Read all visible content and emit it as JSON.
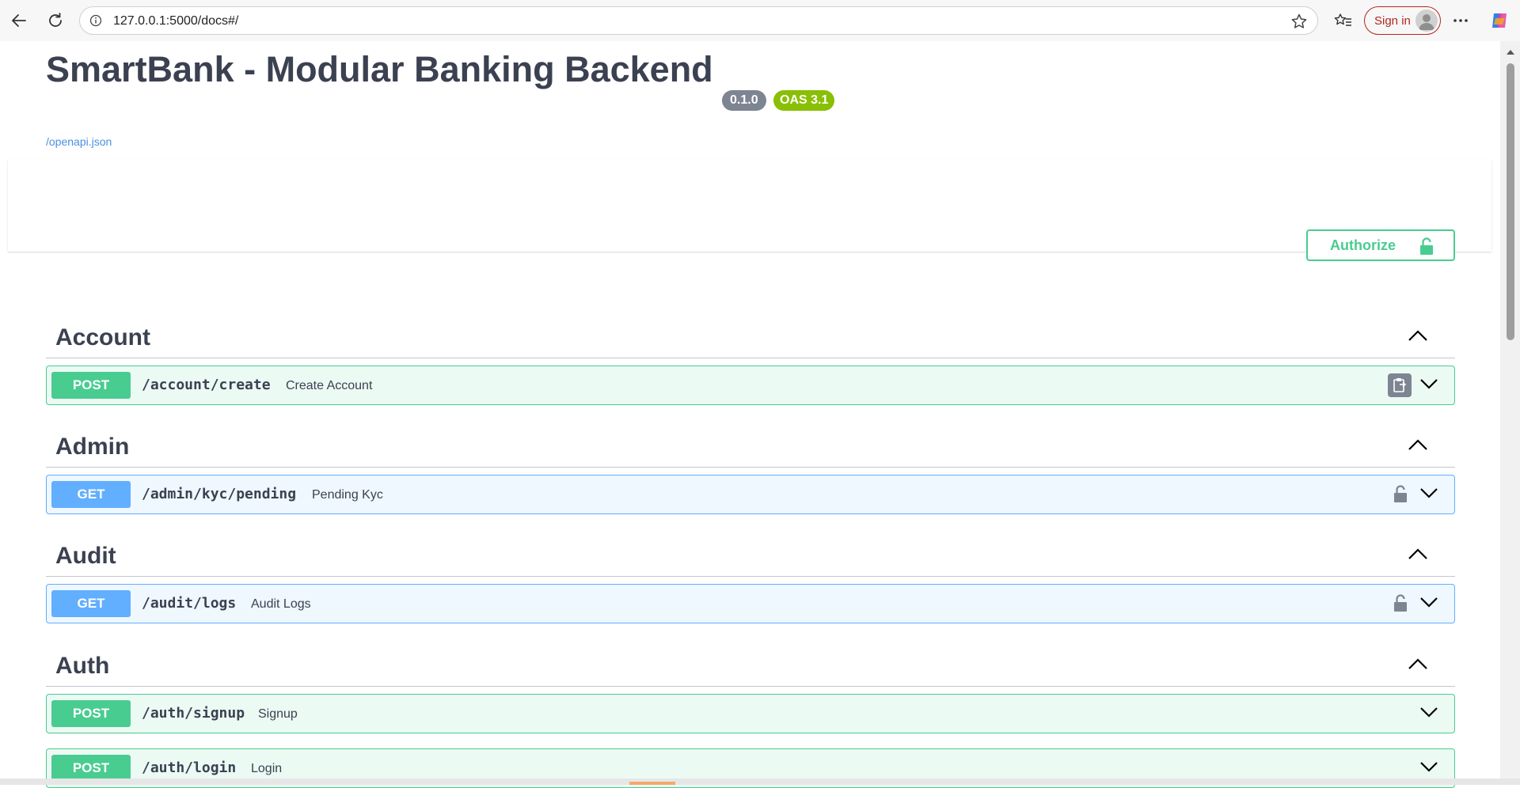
{
  "browser": {
    "url": "127.0.0.1:5000/docs#/",
    "signin_label": "Sign in"
  },
  "page": {
    "title": "SmartBank - Modular Banking Backend",
    "version_badge": "0.1.0",
    "oas_badge": "OAS 3.1",
    "spec_link": "/openapi.json",
    "authorize_label": "Authorize"
  },
  "tags": [
    {
      "name": "Account"
    },
    {
      "name": "Admin"
    },
    {
      "name": "Audit"
    },
    {
      "name": "Auth"
    }
  ],
  "operations": [
    {
      "method": "POST",
      "path": "/account/create",
      "summary": "Create Account",
      "tag": "Account",
      "action_icon": "copy-icon"
    },
    {
      "method": "GET",
      "path": "/admin/kyc/pending",
      "summary": "Pending Kyc",
      "tag": "Admin",
      "action_icon": "lock-icon"
    },
    {
      "method": "GET",
      "path": "/audit/logs",
      "summary": "Audit Logs",
      "tag": "Audit",
      "action_icon": "lock-icon"
    },
    {
      "method": "POST",
      "path": "/auth/signup",
      "summary": "Signup",
      "tag": "Auth",
      "action_icon": ""
    },
    {
      "method": "POST",
      "path": "/auth/login",
      "summary": "Login",
      "tag": "Auth",
      "action_icon": ""
    }
  ],
  "colors": {
    "post": "#49cc90",
    "get": "#61affe",
    "text": "#3b4151",
    "link": "#4990e2",
    "version_badge": "#7d8492",
    "oas_badge": "#89bf04"
  }
}
